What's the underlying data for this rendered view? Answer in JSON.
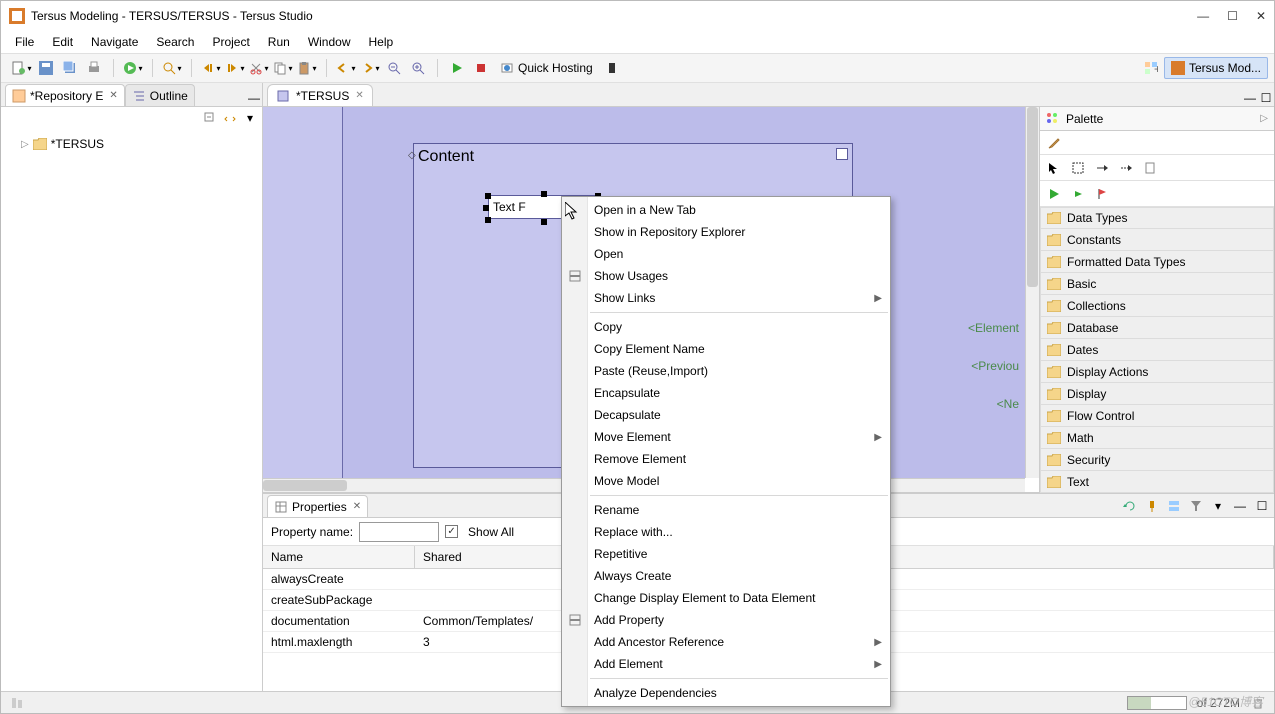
{
  "title": "Tersus Modeling - TERSUS/TERSUS - Tersus Studio",
  "menu": {
    "file": "File",
    "edit": "Edit",
    "navigate": "Navigate",
    "search": "Search",
    "project": "Project",
    "run": "Run",
    "window": "Window",
    "help": "Help"
  },
  "toolbar": {
    "quick_hosting": "Quick Hosting"
  },
  "perspective": {
    "label": "Tersus Mod..."
  },
  "left": {
    "tab_repo": "*Repository E",
    "tab_outline": "Outline",
    "tree_root": "*TERSUS"
  },
  "editor": {
    "tab": "*TERSUS",
    "content_label": "Content",
    "text_field": "Text F",
    "side": {
      "element": "<Element",
      "previous": "<Previou",
      "ne": "<Ne"
    }
  },
  "palette": {
    "title": "Palette",
    "items": [
      "Data Types",
      "Constants",
      "Formatted Data Types",
      "Basic",
      "Collections",
      "Database",
      "Dates",
      "Display Actions",
      "Display",
      "Flow Control",
      "Math",
      "Security",
      "Text"
    ]
  },
  "properties": {
    "tab": "Properties",
    "name_label": "Property name:",
    "show_all": "Show All",
    "col_name": "Name",
    "col_shared": "Shared",
    "rows": [
      {
        "name": "alwaysCreate",
        "shared": ""
      },
      {
        "name": "createSubPackage",
        "shared": ""
      },
      {
        "name": "documentation",
        "shared": "Common/Templates/"
      },
      {
        "name": "html.maxlength",
        "shared": "3"
      }
    ]
  },
  "context_menu": {
    "items": [
      {
        "label": "Open in a New Tab"
      },
      {
        "label": "Show in Repository Explorer"
      },
      {
        "label": "Open"
      },
      {
        "label": "Show Usages",
        "icon": "usages"
      },
      {
        "label": "Show Links",
        "sub": true
      },
      {
        "sep": true
      },
      {
        "label": "Copy"
      },
      {
        "label": "Copy Element Name"
      },
      {
        "label": "Paste (Reuse,Import)"
      },
      {
        "label": "Encapsulate"
      },
      {
        "label": "Decapsulate"
      },
      {
        "label": "Move Element",
        "sub": true
      },
      {
        "label": "Remove Element"
      },
      {
        "label": "Move Model"
      },
      {
        "sep": true
      },
      {
        "label": "Rename"
      },
      {
        "label": "Replace with..."
      },
      {
        "label": "Repetitive"
      },
      {
        "label": "Always Create"
      },
      {
        "label": "Change Display Element to Data Element"
      },
      {
        "label": "Add Property",
        "icon": "add-prop"
      },
      {
        "label": "Add Ancestor Reference",
        "sub": true
      },
      {
        "label": "Add Element",
        "sub": true
      },
      {
        "sep": true
      },
      {
        "label": "Analyze Dependencies"
      }
    ]
  },
  "status": {
    "heap": "of 272M",
    "watermark": "@51CTO博客"
  }
}
